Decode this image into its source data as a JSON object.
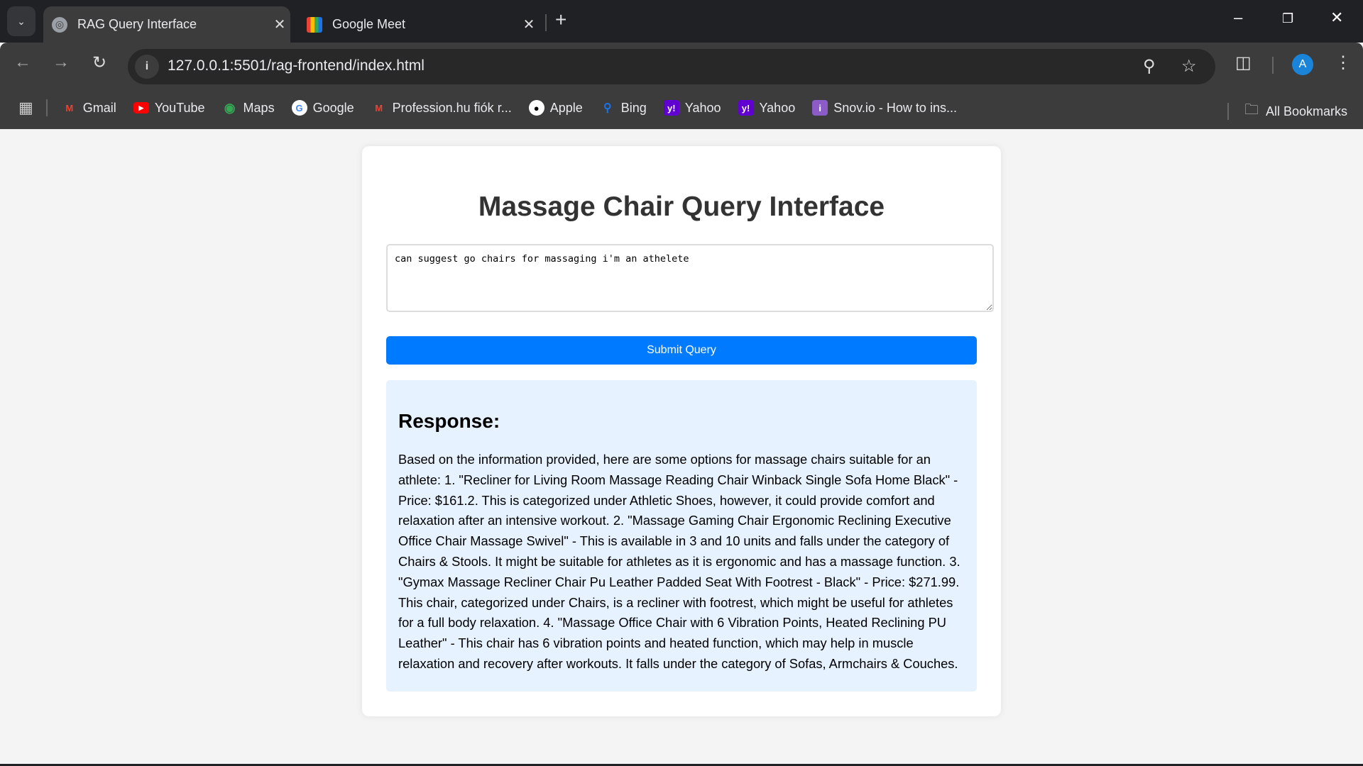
{
  "browser": {
    "tabs": [
      {
        "title": "RAG Query Interface",
        "icon": "globe-icon"
      },
      {
        "title": "Google Meet",
        "icon": "google-meet-icon"
      }
    ],
    "url": "127.0.0.1:5501/rag-frontend/index.html",
    "profile_initial": "A",
    "bookmarks": [
      {
        "label": "Gmail",
        "icon": "gmail-icon",
        "color": "#ea4335"
      },
      {
        "label": "YouTube",
        "icon": "youtube-icon",
        "color": "#ff0000"
      },
      {
        "label": "Maps",
        "icon": "maps-icon",
        "color": "#34a853"
      },
      {
        "label": "Google",
        "icon": "google-icon",
        "color": "#ffffff"
      },
      {
        "label": "Profession.hu fiók r...",
        "icon": "gmail-icon",
        "color": "#ea4335"
      },
      {
        "label": "Apple",
        "icon": "apple-icon",
        "color": "#ffffff"
      },
      {
        "label": "Bing",
        "icon": "search-icon",
        "color": "#1a73e8"
      },
      {
        "label": "Yahoo",
        "icon": "yahoo-icon",
        "color": "#6001d2"
      },
      {
        "label": "Yahoo",
        "icon": "yahoo-icon",
        "color": "#6001d2"
      },
      {
        "label": "Snov.io - How to ins...",
        "icon": "snovio-icon",
        "color": "#8b5cc7"
      }
    ],
    "all_bookmarks": "All Bookmarks"
  },
  "page": {
    "title": "Massage Chair Query Interface",
    "query_value": "can suggest go chairs for massaging i'm an athelete",
    "submit_label": "Submit Query",
    "accent": "#007bff",
    "response_heading": "Response:",
    "response_text": "Based on the information provided, here are some options for massage chairs suitable for an athlete: 1. \"Recliner for Living Room Massage Reading Chair Winback Single Sofa Home Black\" - Price: $161.2. This is categorized under Athletic Shoes, however, it could provide comfort and relaxation after an intensive workout. 2. \"Massage Gaming Chair Ergonomic Reclining Executive Office Chair Massage Swivel\" - This is available in 3 and 10 units and falls under the category of Chairs & Stools. It might be suitable for athletes as it is ergonomic and has a massage function. 3. \"Gymax Massage Recliner Chair Pu Leather Padded Seat With Footrest - Black\" - Price: $271.99. This chair, categorized under Chairs, is a recliner with footrest, which might be useful for athletes for a full body relaxation. 4. \"Massage Office Chair with 6 Vibration Points, Heated Reclining PU Leather\" - This chair has 6 vibration points and heated function, which may help in muscle relaxation and recovery after workouts. It falls under the category of Sofas, Armchairs & Couches."
  }
}
